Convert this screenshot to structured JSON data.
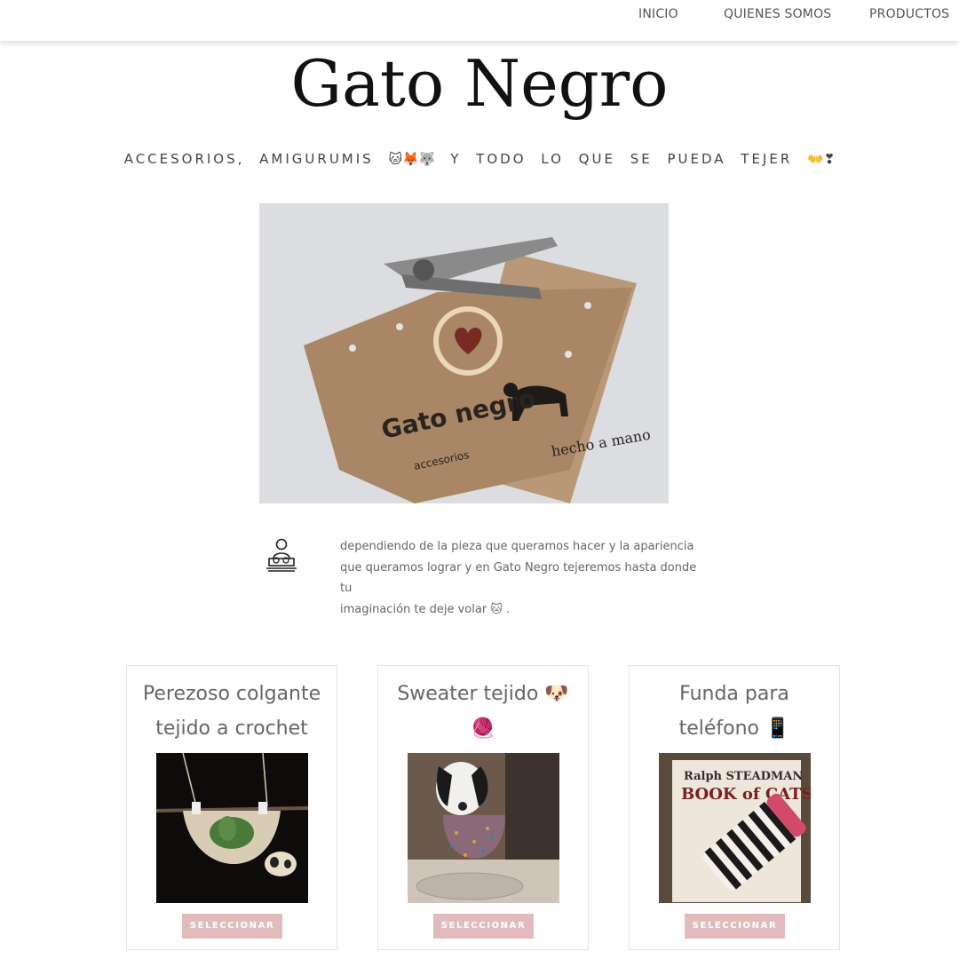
{
  "nav": {
    "inicio": "INICIO",
    "quienes": "QUIENES SOMOS",
    "productos": "PRODUCTOS"
  },
  "site": {
    "title": "Gato Negro",
    "tagline": "ACCESORIOS, AMIGURUMIS",
    "tagline_emojis_1": "🐱🦊🐺",
    "tagline_rest": "Y TODO LO QUE SE PUEDA TEJER",
    "tagline_emojis_2": "👐❣"
  },
  "hero": {
    "bag_text_1": "Gato negro",
    "bag_text_2": "accesorios",
    "bag_text_3": "hecho a mano"
  },
  "intro": {
    "line1": "dependiendo de la pieza que queramos hacer y la apariencia",
    "line2": "que queramos lograr y en Gato Negro tejeremos hasta donde tu",
    "line3": "imaginación te deje volar",
    "line3_emoji": "🐱",
    "line3_end": "."
  },
  "products": [
    {
      "title_1": "Perezoso colgante",
      "title_2": "tejido a crochet",
      "button": "SELECCIONAR"
    },
    {
      "title_1": "Sweater tejido 🐶",
      "title_2": "🧶",
      "button": "SELECCIONAR"
    },
    {
      "title_1": "Funda para",
      "title_2": "teléfono 📱",
      "button": "SELECCIONAR",
      "img_text_1": "Ralph STEADMAN",
      "img_text_2": "BOOK of CATS"
    }
  ],
  "colors": {
    "button_bg": "#e2bcbd",
    "nav_text": "#555555",
    "hero_bg": "#dadbdd"
  }
}
